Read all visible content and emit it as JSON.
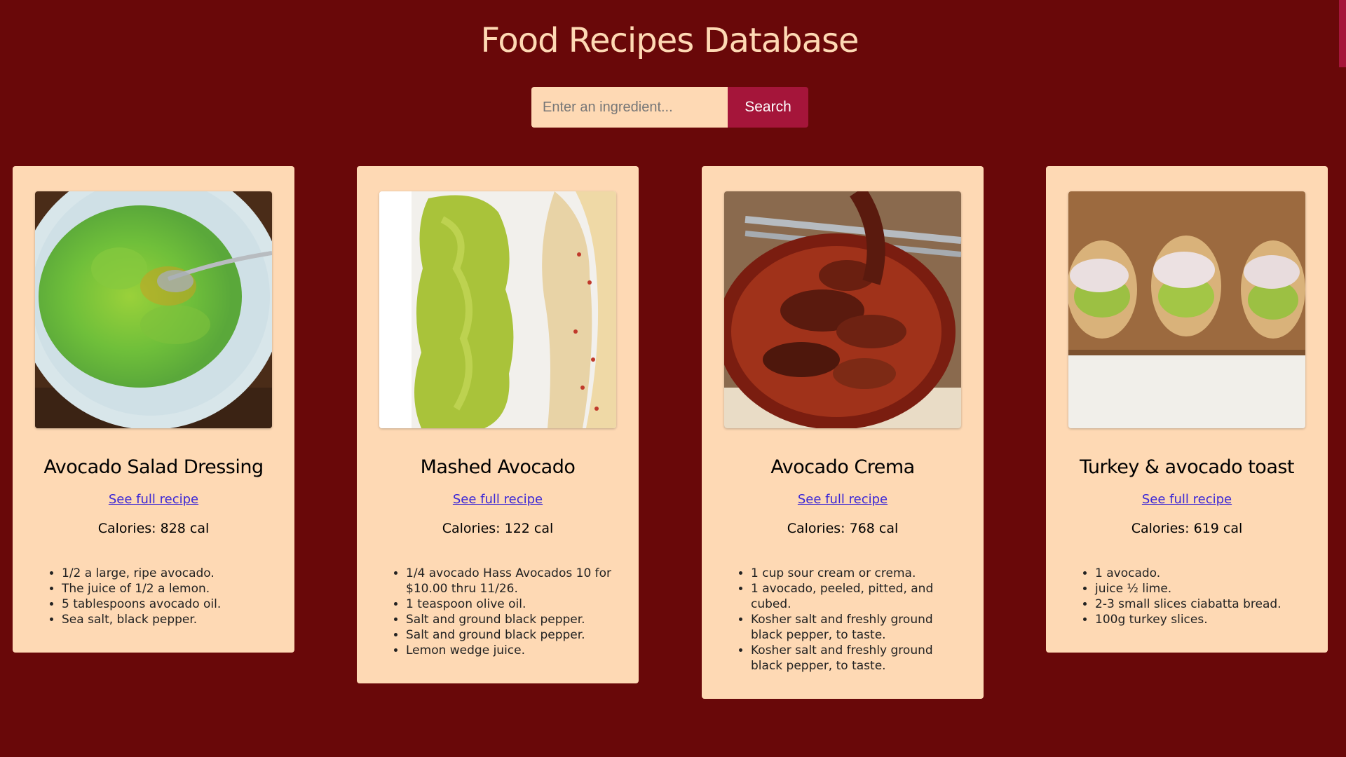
{
  "page": {
    "title": "Food Recipes Database"
  },
  "search": {
    "placeholder": "Enter an ingredient...",
    "button_label": "Search"
  },
  "colors": {
    "background": "#690809",
    "title": "#fed9b4",
    "card": "#fed9b4",
    "accent": "#a5153a",
    "link": "#3b27d6"
  },
  "recipes": [
    {
      "title": "Avocado Salad Dressing",
      "link_label": "See full recipe",
      "calories": "Calories: 828 cal",
      "image": "avocado-dressing-bowl-photo",
      "ingredients": [
        "1/2 a large, ripe avocado.",
        "The juice of 1/2 a lemon.",
        "5 tablespoons avocado oil.",
        "Sea salt, black pepper."
      ]
    },
    {
      "title": "Mashed Avocado",
      "link_label": "See full recipe",
      "calories": "Calories: 122 cal",
      "image": "mashed-avocado-hummus-photo",
      "ingredients": [
        "1/4 avocado Hass Avocados 10 for $10.00 thru 11/26.",
        "1 teaspoon olive oil.",
        "Salt and ground black pepper.",
        "Salt and ground black pepper.",
        "Lemon wedge juice."
      ]
    },
    {
      "title": "Avocado Crema",
      "link_label": "See full recipe",
      "calories": "Calories: 768 cal",
      "image": "chicken-wings-bowl-photo",
      "ingredients": [
        "1 cup sour cream or crema.",
        "1 avocado, peeled, pitted, and cubed.",
        "Kosher salt and freshly ground black pepper, to taste.",
        "Kosher salt and freshly ground black pepper, to taste."
      ]
    },
    {
      "title": "Turkey & avocado toast",
      "link_label": "See full recipe",
      "calories": "Calories: 619 cal",
      "image": "turkey-avocado-toast-photo",
      "ingredients": [
        "1 avocado.",
        "juice ½ lime.",
        "2-3 small slices ciabatta bread.",
        "100g turkey slices."
      ]
    }
  ]
}
